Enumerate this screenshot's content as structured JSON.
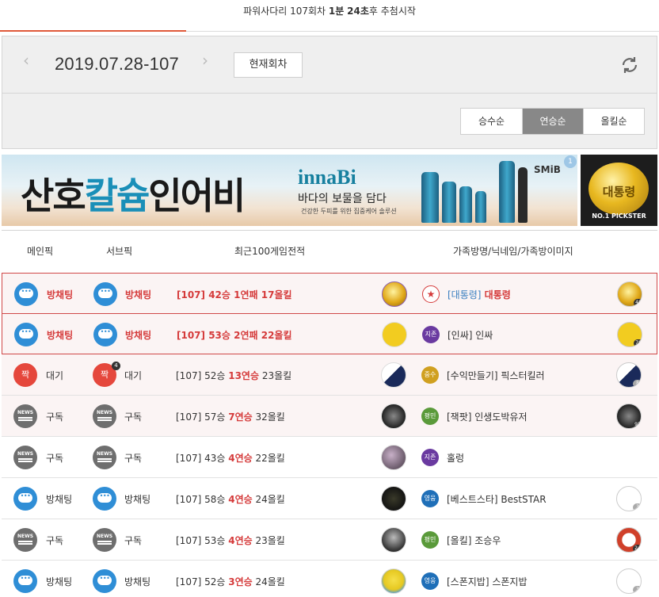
{
  "countdown": {
    "prefix": "파워사다리 107회차 ",
    "minutes": "1분",
    "seconds": "24초",
    "suffix": "후 추첨시작"
  },
  "date_nav": {
    "prev_icon": "chevron-left-icon",
    "date": "2019.07.28-107",
    "next_icon": "chevron-right-icon",
    "current_label": "현재회차",
    "refresh_icon": "refresh-icon"
  },
  "sort": {
    "options": [
      "승수순",
      "연승순",
      "올킬순"
    ],
    "active": "연승순"
  },
  "banner": {
    "title_a": "산호",
    "title_b": "칼슘",
    "title_c": "인어비",
    "brand": "innaBi",
    "tagline": "바다의 보물을 담다",
    "small": "건강한 두피를 위한 집중케어 솔루션",
    "product": "SMiB",
    "badge": "1"
  },
  "banner2": {
    "medal_text": "대통령",
    "pick_text": "NO.1 PICKSTER"
  },
  "table": {
    "headers": {
      "main": "메인픽",
      "sub": "서브픽",
      "recent": "최근100게임전적",
      "family": "가족방명/닉네임/가족방이미지"
    },
    "rows": [
      {
        "main_icon": "chat-icon",
        "main": "방채팅",
        "sub_icon": "chat-icon",
        "sub": "방채팅",
        "rec_a": "[107] 42승 1연패 17올킬",
        "rec_hot": "",
        "rec_b": "",
        "rank": "★",
        "fam_room": "[대통령]",
        "fam_nick": " 대통령",
        "fam_tag": "40"
      },
      {
        "main_icon": "chat-icon",
        "main": "방채팅",
        "sub_icon": "chat-icon",
        "sub": "방채팅",
        "rec_a": "[107] 53승 2연패 22올킬",
        "rec_hot": "",
        "rec_b": "",
        "rank": "지존",
        "fam_room": "[인싸]",
        "fam_nick": " 인싸",
        "fam_tag": "70"
      },
      {
        "main_icon": "jjak-icon",
        "main_badge": "짝",
        "main": "대기",
        "sub_icon": "jjak-icon",
        "sub_badge": "짝",
        "sub_dot": "4",
        "sub": "대기",
        "rec_a": "[107] 52승 ",
        "rec_hot": "13연승",
        "rec_b": " 23올킬",
        "rank": "중수",
        "fam_room": "[수익만들기]",
        "fam_nick": " 픽스터킬러",
        "fam_tag": "8"
      },
      {
        "main_icon": "news-icon",
        "main": "구독",
        "sub_icon": "news-icon",
        "sub": "구독",
        "rec_a": "[107] 57승 ",
        "rec_hot": "7연승",
        "rec_b": " 32올킬",
        "rank": "평민",
        "fam_room": "[잭팟]",
        "fam_nick": " 인생도박유저",
        "fam_tag": "95"
      },
      {
        "main_icon": "news-icon",
        "main": "구독",
        "sub_icon": "news-icon",
        "sub": "구독",
        "rec_a": "[107] 43승 ",
        "rec_hot": "4연승",
        "rec_b": " 22올킬",
        "rank": "지존",
        "fam_room": "",
        "fam_nick": "홀렁",
        "fam_tag": ""
      },
      {
        "main_icon": "chat-icon",
        "main": "방채팅",
        "sub_icon": "chat-icon",
        "sub": "방채팅",
        "rec_a": "[107] 58승 ",
        "rec_hot": "4연승",
        "rec_b": " 24올킬",
        "rank": "영웅",
        "fam_room": "[베스트스타]",
        "fam_nick": " BestSTAR",
        "fam_tag": "3"
      },
      {
        "main_icon": "news-icon",
        "main": "구독",
        "sub_icon": "news-icon",
        "sub": "구독",
        "rec_a": "[107] 53승 ",
        "rec_hot": "4연승",
        "rec_b": " 23올킬",
        "rank": "평민",
        "fam_room": "[올킬]",
        "fam_nick": " 조승우",
        "fam_tag": "24"
      },
      {
        "main_icon": "chat-icon",
        "main": "방채팅",
        "sub_icon": "chat-icon",
        "sub": "방채팅",
        "rec_a": "[107] 52승 ",
        "rec_hot": "3연승",
        "rec_b": " 24올킬",
        "rank": "영웅",
        "fam_room": "[스폰지밥]",
        "fam_nick": " 스폰지밥",
        "fam_tag": "3"
      }
    ]
  },
  "colors": {
    "accent_red": "#d53a3a",
    "chat_blue": "#2f8ed6",
    "news_gray": "#6e6e6e",
    "rank_jijon": "#6a3aa0",
    "rank_jungsu": "#d0a020",
    "rank_pyeongmin": "#5a9a3a",
    "rank_yeongung": "#1f6fb8"
  }
}
